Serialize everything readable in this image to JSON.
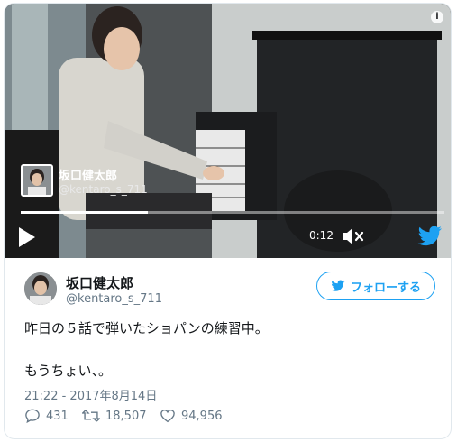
{
  "video": {
    "author_name": "坂口健太郎",
    "author_handle": "@kentaro_s_711",
    "time": "0:12",
    "progress": 0.3,
    "info_icon": "info-icon",
    "play_icon": "play-icon",
    "volume_icon": "volume-muted-icon",
    "brand_icon": "twitter-bird-icon"
  },
  "tweet": {
    "author_name": "坂口健太郎",
    "author_handle": "@kentaro_s_711",
    "follow_label": "フォローする",
    "text_line1": "昨日の５話で弾いたショパンの練習中。",
    "text_line2": "もうちょい、。",
    "timestamp": "21:22 - 2017年8月14日",
    "replies": "431",
    "retweets": "18,507",
    "likes": "94,956"
  },
  "colors": {
    "accent": "#1da1f2",
    "muted_text": "#657786",
    "border": "#e1e8ed"
  }
}
